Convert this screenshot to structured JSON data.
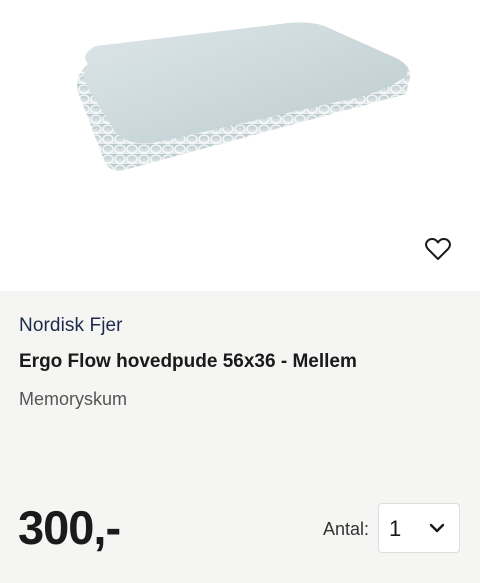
{
  "product": {
    "image_alt": "pillow-product-image",
    "brand": "Nordisk Fjer",
    "title": "Ergo Flow hovedpude 56x36 - Mellem",
    "subtitle": "Memoryskum",
    "price": "300,-"
  },
  "wishlist": {
    "icon": "heart-outline-icon"
  },
  "quantity": {
    "label": "Antal:",
    "selected": "1",
    "icon": "chevron-down-icon"
  },
  "colors": {
    "info_background": "#f5f5f3",
    "brand_text": "#1d2b4a",
    "pillow": "#c9d6d8"
  }
}
